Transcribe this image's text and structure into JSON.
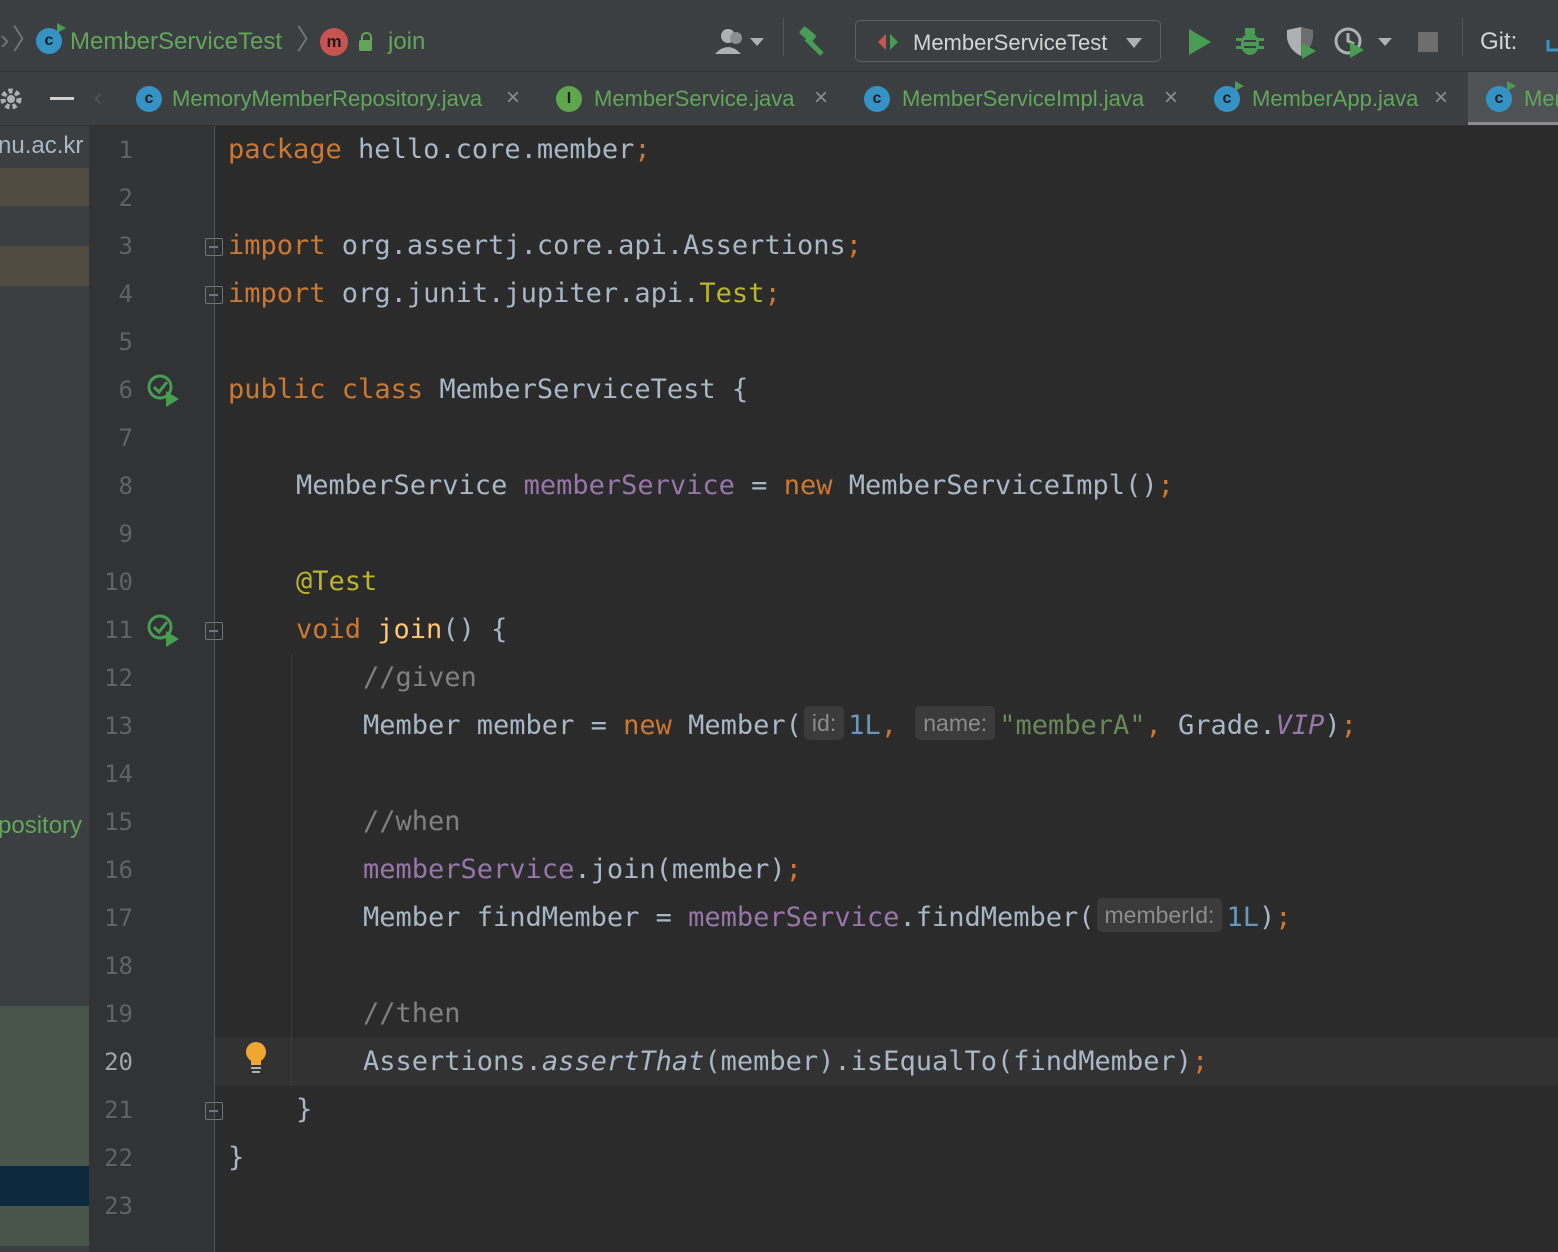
{
  "breadcrumb": {
    "class_name": "MemberServiceTest",
    "method_name": "join",
    "method_icon_letter": "m",
    "class_icon_letter": "c"
  },
  "toolbar": {
    "run_config_label": "MemberServiceTest",
    "git_label": "Git:",
    "icons": [
      "user-icon",
      "build-hammer-icon",
      "run-icon",
      "debug-icon",
      "coverage-icon",
      "profile-icon",
      "stop-icon"
    ]
  },
  "tabs": [
    {
      "label": "MemoryMemberRepository.java",
      "icon_letter": "c",
      "kind": "class",
      "close": "×"
    },
    {
      "label": "MemberService.java",
      "icon_letter": "I",
      "kind": "interface",
      "close": "×"
    },
    {
      "label": "MemberServiceImpl.java",
      "icon_letter": "c",
      "kind": "class",
      "close": "×"
    },
    {
      "label": "MemberApp.java",
      "icon_letter": "c",
      "kind": "class",
      "close": "×"
    },
    {
      "label": "Mem",
      "icon_letter": "c",
      "kind": "class",
      "active": true
    }
  ],
  "left_panel": {
    "top_text": "nu.ac.kr",
    "mid_text": "pository"
  },
  "editor": {
    "current_line": 20,
    "line_numbers": [
      "1",
      "2",
      "3",
      "4",
      "5",
      "6",
      "7",
      "8",
      "9",
      "10",
      "11",
      "12",
      "13",
      "14",
      "15",
      "16",
      "17",
      "18",
      "19",
      "20",
      "21",
      "22",
      "23"
    ],
    "code": {
      "l1": {
        "kw": "package",
        "rest": " hello.core.member",
        "semi": ";"
      },
      "l3": {
        "kw": "import",
        "rest": " org.assertj.core.api.Assertions",
        "semi": ";"
      },
      "l4": {
        "kw": "import",
        "rest": " org.junit.jupiter.api.",
        "ann": "Test",
        "semi": ";"
      },
      "l6": {
        "kw1": "public",
        "kw2": " class",
        "rest": " MemberServiceTest {"
      },
      "l8": {
        "type": "MemberService ",
        "field": "memberService",
        "eq": " = ",
        "kw": "new",
        "rest": " MemberServiceImpl()",
        "semi": ";"
      },
      "l10": {
        "ann": "@Test"
      },
      "l11": {
        "kw": "void",
        "fn": " join",
        "rest": "() {"
      },
      "l12": {
        "cmt": "//given"
      },
      "l13": {
        "a": "Member member = ",
        "kw": "new",
        "b": " Member(",
        "hint1": "id:",
        "num": "1L",
        "comma1": ",",
        "hint2": "name:",
        "str": "\"memberA\"",
        "comma2": ",",
        "c": " Grade.",
        "field": "VIP",
        "d": ")",
        "semi": ";"
      },
      "l15": {
        "cmt": "//when"
      },
      "l16": {
        "field": "memberService",
        "rest": ".join(member)",
        "semi": ";"
      },
      "l17": {
        "a": "Member findMember = ",
        "field": "memberService",
        "b": ".findMember(",
        "hint": "memberId:",
        "num": "1L",
        "c": ")",
        "semi": ";"
      },
      "l19": {
        "cmt": "//then"
      },
      "l20": {
        "a": "Assertions.",
        "ital": "assertThat",
        "b": "(member).isEqualTo(findMember)",
        "semi": ";"
      },
      "l21": {
        "rest": "}"
      },
      "l22": {
        "rest": "}"
      }
    }
  }
}
